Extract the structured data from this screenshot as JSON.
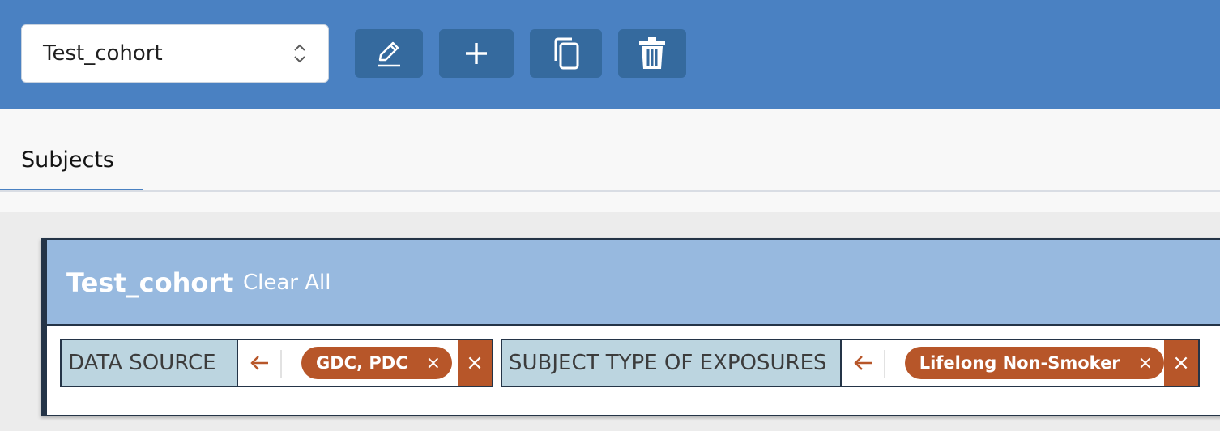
{
  "header": {
    "cohort_select_value": "Test_cohort",
    "buttons": [
      {
        "name": "edit",
        "icon": "pencil-icon"
      },
      {
        "name": "add",
        "icon": "plus-icon"
      },
      {
        "name": "duplicate",
        "icon": "copy-icon"
      },
      {
        "name": "delete",
        "icon": "trash-icon"
      }
    ]
  },
  "tabs": [
    {
      "label": "Subjects",
      "active": true
    }
  ],
  "cohort_panel": {
    "title": "Test_cohort",
    "clear_all_label": "Clear All",
    "filters": [
      {
        "label": "DATA SOURCE",
        "value": "GDC, PDC",
        "chip_remove": "×",
        "remove": "×"
      },
      {
        "label": "SUBJECT TYPE OF EXPOSURES",
        "value": "Lifelong Non-Smoker",
        "chip_remove": "×",
        "remove": "×"
      }
    ]
  },
  "colors": {
    "header_bg": "#4a81c2",
    "button_bg": "#356a9e",
    "panel_header_bg": "#97b9df",
    "filter_label_bg": "#bcd5e0",
    "chip_bg": "#b75629"
  }
}
